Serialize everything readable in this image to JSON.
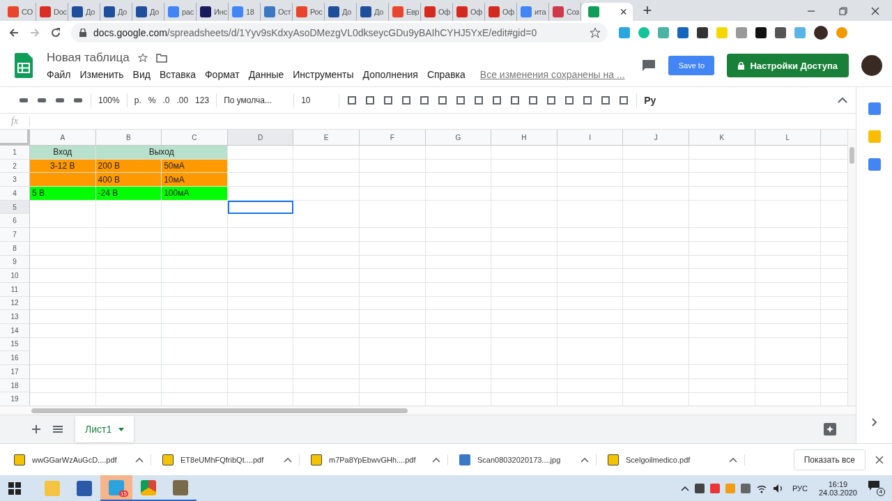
{
  "browser": {
    "tabs": [
      {
        "kind": "shop",
        "label": "CO",
        "selected": false
      },
      {
        "kind": "mail",
        "label": "Doc",
        "selected": false
      },
      {
        "kind": "gov",
        "label": "До",
        "selected": false
      },
      {
        "kind": "gov",
        "label": "До",
        "selected": false
      },
      {
        "kind": "gov",
        "label": "До",
        "selected": false
      },
      {
        "kind": "google",
        "label": "рас",
        "selected": false
      },
      {
        "kind": "t",
        "label": "Инс",
        "selected": false
      },
      {
        "kind": "google",
        "label": "18",
        "selected": false
      },
      {
        "kind": "circle",
        "label": "Ост",
        "selected": false
      },
      {
        "kind": "tv",
        "label": "Рос",
        "selected": false
      },
      {
        "kind": "gov",
        "label": "До",
        "selected": false
      },
      {
        "kind": "gov",
        "label": "До",
        "selected": false
      },
      {
        "kind": "tv",
        "label": "Евр",
        "selected": false
      },
      {
        "kind": "flag",
        "label": "Оф",
        "selected": false
      },
      {
        "kind": "flag",
        "label": "Оф",
        "selected": false
      },
      {
        "kind": "flag",
        "label": "Оф",
        "selected": false
      },
      {
        "kind": "google",
        "label": "ита",
        "selected": false
      },
      {
        "kind": "mc",
        "label": "Соз",
        "selected": false
      },
      {
        "kind": "sheets",
        "close": "×",
        "selected": true
      }
    ],
    "new_tab": "+",
    "url_host": "docs.google.com",
    "url_path": "/spreadsheets/d/1Yyv9sKdxyAsoDMezgVL0dkseycGDu9yBAIhCYHJ5YxE/edit#gid=0"
  },
  "doc": {
    "title": "Новая таблица",
    "menu": [
      "Файл",
      "Изменить",
      "Вид",
      "Вставка",
      "Формат",
      "Данные",
      "Инструменты",
      "Дополнения",
      "Справка"
    ],
    "save_status": "Все изменения сохранены на ...",
    "save_to": "Save to",
    "share": "Настройки Доступа"
  },
  "toolbar": {
    "zoom": "100%",
    "currency": "р.",
    "percent": "%",
    "dec_less": ".0",
    "dec_more": ".00",
    "format": "123",
    "font": "По умолча...",
    "size": "10",
    "input_tools": "Ру"
  },
  "formula_bar": {
    "label": "fx"
  },
  "sheet": {
    "columns": [
      "A",
      "B",
      "C",
      "D",
      "E",
      "F",
      "G",
      "H",
      "I",
      "J",
      "K",
      "L"
    ],
    "rows": [
      {
        "label": "1",
        "cells": [
          {
            "kind": "single",
            "text": "Вход",
            "color": "#b7e1cd",
            "centered": true
          },
          {
            "kind": "merged",
            "text": "Выход",
            "color": "#b7e1cd",
            "centered": true
          }
        ]
      },
      {
        "label": "2",
        "cells": [
          {
            "kind": "single",
            "text": "3-12 В",
            "color": "#ff9900",
            "centered": true
          },
          {
            "kind": "single",
            "text": "200 В",
            "color": "#ff9900",
            "centered": false
          },
          {
            "kind": "single",
            "text": "50мА",
            "color": "#ff9900",
            "centered": false
          }
        ]
      },
      {
        "label": "3",
        "cells": [
          {
            "kind": "single",
            "color": "#ff9900"
          },
          {
            "kind": "single",
            "text": "400 В",
            "color": "#ff9900",
            "centered": false
          },
          {
            "kind": "single",
            "text": "10мА",
            "color": "#ff9900",
            "centered": false
          }
        ]
      },
      {
        "label": "4",
        "cells": [
          {
            "kind": "single",
            "text": "5 В",
            "color": "#00ff00",
            "centered": false
          },
          {
            "kind": "single",
            "text": "-24 В",
            "color": "#00ff00",
            "centered": false
          },
          {
            "kind": "single",
            "text": "100мА",
            "color": "#00ff00",
            "centered": false
          }
        ]
      },
      {
        "label": "5",
        "cells": [
          {
            "kind": "single",
            "selected": false
          },
          {
            "kind": "single",
            "selected": false
          },
          {
            "kind": "single",
            "selected": false
          },
          {
            "kind": "single",
            "selected": true
          }
        ]
      },
      {
        "label": "6"
      },
      {
        "label": "7"
      },
      {
        "label": "8"
      },
      {
        "label": "9"
      },
      {
        "label": "10"
      },
      {
        "label": "11"
      },
      {
        "label": "12"
      },
      {
        "label": "13"
      },
      {
        "label": "14"
      },
      {
        "label": "15"
      },
      {
        "label": "16"
      },
      {
        "label": "17"
      },
      {
        "label": "18"
      },
      {
        "label": "19"
      }
    ]
  },
  "sheet_tabs": [
    {
      "label": "Лист1",
      "selected": true
    }
  ],
  "downloads": {
    "files": [
      {
        "kind": "pdf",
        "name": "wwGGarWzAuGcD....pdf"
      },
      {
        "kind": "pdf",
        "name": "ET8eUMhFQfribQt....pdf"
      },
      {
        "kind": "pdf",
        "name": "m7Pa8YpEbwvGHh....pdf"
      },
      {
        "kind": "image",
        "name": "Scan08032020173....jpg"
      },
      {
        "kind": "pdf",
        "name": "Scelgoilmedico.pdf"
      }
    ],
    "show_all": "Показать все"
  },
  "taskbar": {
    "telegram_badge": "15",
    "language": "РУС",
    "time": "16:19",
    "date": "24.03.2020",
    "notifications": "4"
  }
}
